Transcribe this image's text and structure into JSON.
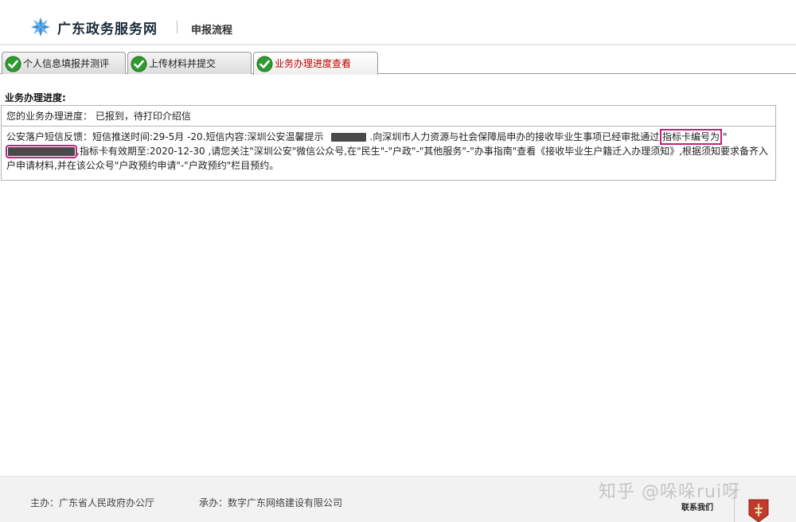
{
  "header": {
    "site_name": "广东政务服务网",
    "page_title": "申报流程"
  },
  "tabs": [
    {
      "label": "个人信息填报并测评",
      "active": false
    },
    {
      "label": "上传材料并提交",
      "active": false
    },
    {
      "label": "业务办理进度查看",
      "active": true
    }
  ],
  "progress": {
    "section_title": "业务办理进度:",
    "status_label": "您的业务办理进度：",
    "status_value": "已报到，待打印介绍信",
    "sms_part1": "公安落户短信反馈：短信推送时间:29-5月 -20.短信内容:深圳公安温馨提示",
    "sms_part2": ".向深圳市人力资源与社会保障局申办的接收毕业生事项已经审批通过,",
    "sms_highlight": "指标卡编号为",
    "sms_part3": "\"",
    "sms_part4": ",指标卡有效期至:2020-12-30 ,请您关注\"深圳公安\"微信公众号,在\"民生\"-\"户政\"-\"其他服务\"-\"办事指南\"查看《接收毕业生户籍迁入办理须知》,根据须知要求备齐入户申请材料,并在该公众号\"户政预约申请\"-\"户政预约\"栏目预约。"
  },
  "footer": {
    "host": "主办：广东省人民政府办公厅",
    "undertaker": "承办：数字广东网络建设有限公司",
    "contact": "联系我们"
  },
  "watermark": "知乎 @哚哚rui呀",
  "colors": {
    "active_tab_text": "#c00000",
    "highlight_box": "#c0227a",
    "check_green": "#2e9b2e"
  }
}
